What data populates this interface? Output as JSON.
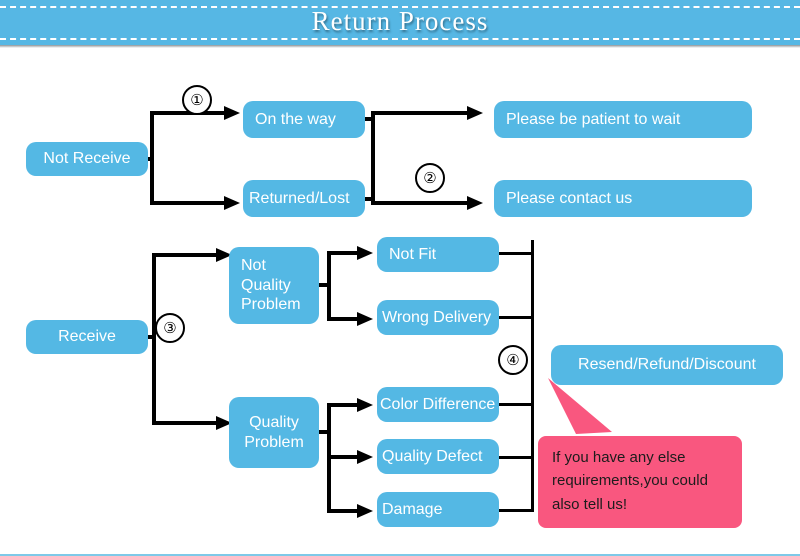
{
  "header": {
    "title": "Return Process",
    "background_color": "#56b7e4",
    "title_color": "#ffffff"
  },
  "theme": {
    "node_color": "#54b8e4",
    "node_text_color": "#ffffff",
    "callout_color": "#f9577f",
    "connector_color": "#000000",
    "footer_rule_color": "#7ec9e8"
  },
  "flow": {
    "branch_markers": [
      {
        "id": "marker-1",
        "label": "①"
      },
      {
        "id": "marker-2",
        "label": "②"
      },
      {
        "id": "marker-3",
        "label": "③"
      },
      {
        "id": "marker-4",
        "label": "④"
      }
    ],
    "nodes": [
      {
        "id": "not-receive",
        "label": "Not Receive"
      },
      {
        "id": "on-the-way",
        "label": "On the way"
      },
      {
        "id": "returned-lost",
        "label": "Returned/Lost"
      },
      {
        "id": "please-be-patient",
        "label": "Please be patient to wait"
      },
      {
        "id": "please-contact-us",
        "label": "Please contact us"
      },
      {
        "id": "receive",
        "label": "Receive"
      },
      {
        "id": "not-quality-problem",
        "label": "Not\nQuality\nProblem"
      },
      {
        "id": "quality-problem",
        "label": "Quality\nProblem"
      },
      {
        "id": "not-fit",
        "label": "Not Fit"
      },
      {
        "id": "wrong-delivery",
        "label": "Wrong Delivery"
      },
      {
        "id": "color-difference",
        "label": "Color Difference"
      },
      {
        "id": "quality-defect",
        "label": "Quality Defect"
      },
      {
        "id": "damage",
        "label": "Damage"
      },
      {
        "id": "resend-refund",
        "label": "Resend/Refund/Discount"
      }
    ]
  },
  "callout": {
    "text": "If you have any else requirements,you could also tell us!"
  }
}
